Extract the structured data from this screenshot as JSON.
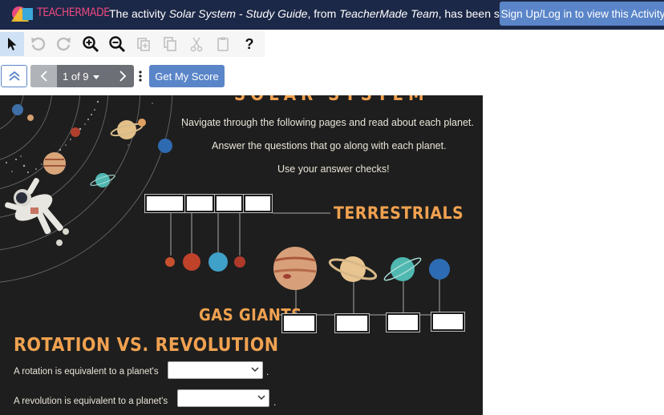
{
  "banner": {
    "logo_text": "TEACHERMADE",
    "msg_prefix": "The activity ",
    "activity_title": "Solar System - Study Guide",
    "msg_from": ", from ",
    "author": "TeacherMade Team",
    "msg_suffix": ", has been shared.",
    "signup_label": "Sign Up/Log in to view this Activity"
  },
  "toolbar": {
    "tools": [
      "pointer-icon",
      "undo-icon",
      "redo-icon",
      "zoom-in-icon",
      "zoom-out-icon",
      "duplicate-icon",
      "copy-icon",
      "cut-icon",
      "paste-icon",
      "help-icon"
    ],
    "help_label": "?"
  },
  "nav": {
    "page_label": "1 of 9",
    "score_label": "Get My Score"
  },
  "activity": {
    "title_partial": "SOLAR SYSTEM",
    "instructions": [
      "Navigate through the following pages and read about each planet.",
      "Answer the questions that go along with each planet.",
      "Use your answer checks!"
    ],
    "terrestrials_label": "TERRESTRIALS",
    "gas_giants_label": "GAS GIANTS",
    "rotation_heading": "ROTATION VS. REVOLUTION",
    "rotation_question": "A rotation is equivalent to a planet's",
    "revolution_question": "A revolution is equivalent to a planet's",
    "rotation_answer": "",
    "revolution_answer": "",
    "period": "."
  },
  "colors": {
    "banner_bg": "#1c2847",
    "accent_blue": "#5a85c8",
    "heading_orange": "#f0a150",
    "page_bg": "#1e1e1e"
  }
}
